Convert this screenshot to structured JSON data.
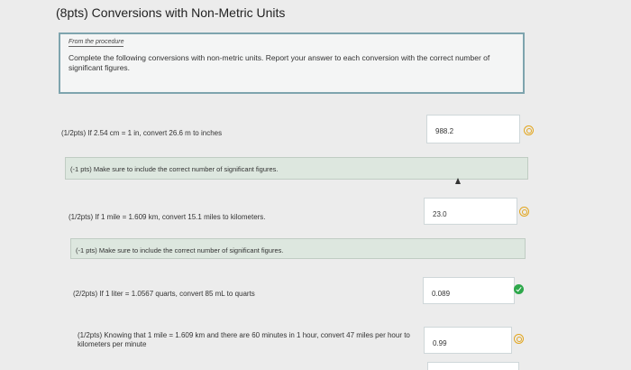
{
  "page": {
    "title": "(8pts) Conversions with Non-Metric Units"
  },
  "procedure": {
    "label": "From the procedure",
    "text": "Complete the following conversions with non-metric units. Report your answer to each conversion with the correct number of significant figures."
  },
  "questions": [
    {
      "prompt": "(1/2pts)  If 2.54 cm = 1 in, convert 26.6 m to inches",
      "answer": "988.2",
      "status": "partial"
    },
    {
      "prompt": "(1/2pts)  If 1 mile = 1.609 km, convert 15.1 miles to kilometers.",
      "answer": "23.0",
      "status": "partial"
    },
    {
      "prompt": "(2/2pts)  If 1 liter = 1.0567 quarts, convert 85 mL to quarts",
      "answer": "0.089",
      "status": "correct"
    },
    {
      "prompt": "(1/2pts)  Knowing that 1 mile = 1.609 km and there are 60 minutes in 1 hour, convert 47 miles per hour to kilometers per minute",
      "answer": "0.99",
      "status": "partial"
    }
  ],
  "feedback": [
    "(-1 pts) Make sure to include the correct number of significant figures.",
    "(-1 pts) Make sure to include the correct number of significant figures."
  ],
  "colors": {
    "partial": "#e2a620",
    "correct": "#2ea84b",
    "feedback_bg": "#dde7df",
    "procedure_border": "#7ea4ae"
  }
}
